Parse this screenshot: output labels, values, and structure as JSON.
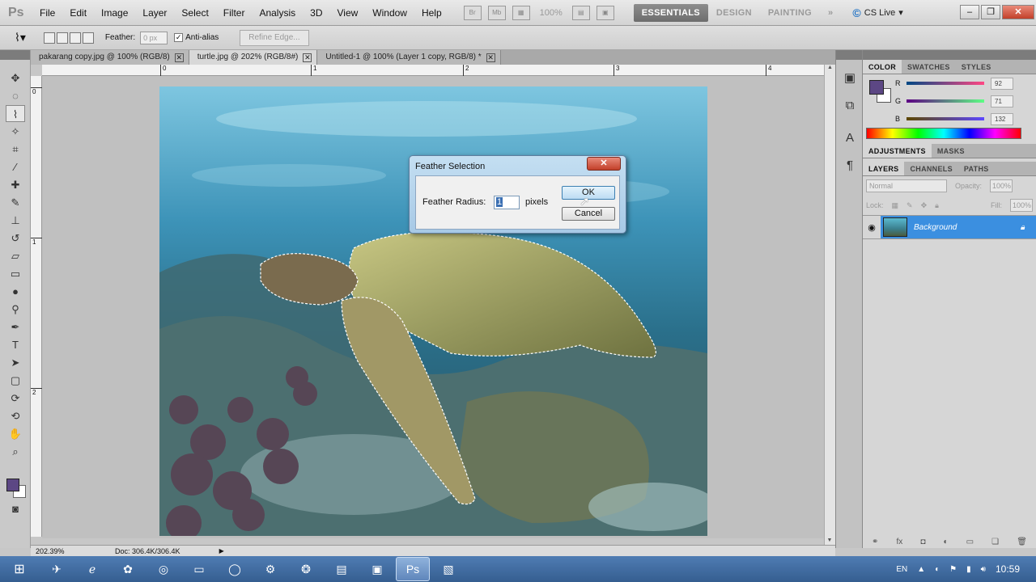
{
  "app": {
    "logo": "Ps"
  },
  "menu": [
    "File",
    "Edit",
    "Image",
    "Layer",
    "Select",
    "Filter",
    "Analysis",
    "3D",
    "View",
    "Window",
    "Help"
  ],
  "menubar_icons": {
    "br": "Br",
    "mb": "Mb",
    "zoom": "100%"
  },
  "workspaces": [
    "ESSENTIALS",
    "DESIGN",
    "PAINTING"
  ],
  "workspace_more": "»",
  "cs_live": "CS Live",
  "options": {
    "feather_label": "Feather:",
    "feather_value": "0 px",
    "antialias_label": "Anti-alias",
    "refine_edge": "Refine Edge..."
  },
  "documents": [
    {
      "label": "pakarang copy.jpg @ 100% (RGB/8)"
    },
    {
      "label": "turtle.jpg @ 202% (RGB/8#)"
    },
    {
      "label": "Untitled-1 @ 100% (Layer 1 copy, RGB/8) *"
    }
  ],
  "rulers": {
    "h": [
      "0",
      "1",
      "2",
      "3",
      "4"
    ],
    "v": [
      "0",
      "1",
      "2"
    ]
  },
  "status": {
    "zoom": "202.39%",
    "doc": "Doc: 306.4K/306.4K"
  },
  "dialog": {
    "title": "Feather Selection",
    "label": "Feather Radius:",
    "value": "1",
    "unit": "pixels",
    "ok": "OK",
    "cancel": "Cancel"
  },
  "color_panel": {
    "tabs": [
      "COLOR",
      "SWATCHES",
      "STYLES"
    ],
    "r_label": "R",
    "g_label": "G",
    "b_label": "B",
    "r": "92",
    "g": "71",
    "b": "132",
    "foreground": "#5c4784"
  },
  "adjust_tabs": [
    "ADJUSTMENTS",
    "MASKS"
  ],
  "layers_panel": {
    "tabs": [
      "LAYERS",
      "CHANNELS",
      "PATHS"
    ],
    "blend": "Normal",
    "opacity_label": "Opacity:",
    "opacity": "100%",
    "lock_label": "Lock:",
    "fill_label": "Fill:",
    "fill": "100%",
    "layer_name": "Background"
  },
  "taskbar": {
    "lang": "EN",
    "time": "10:59"
  }
}
